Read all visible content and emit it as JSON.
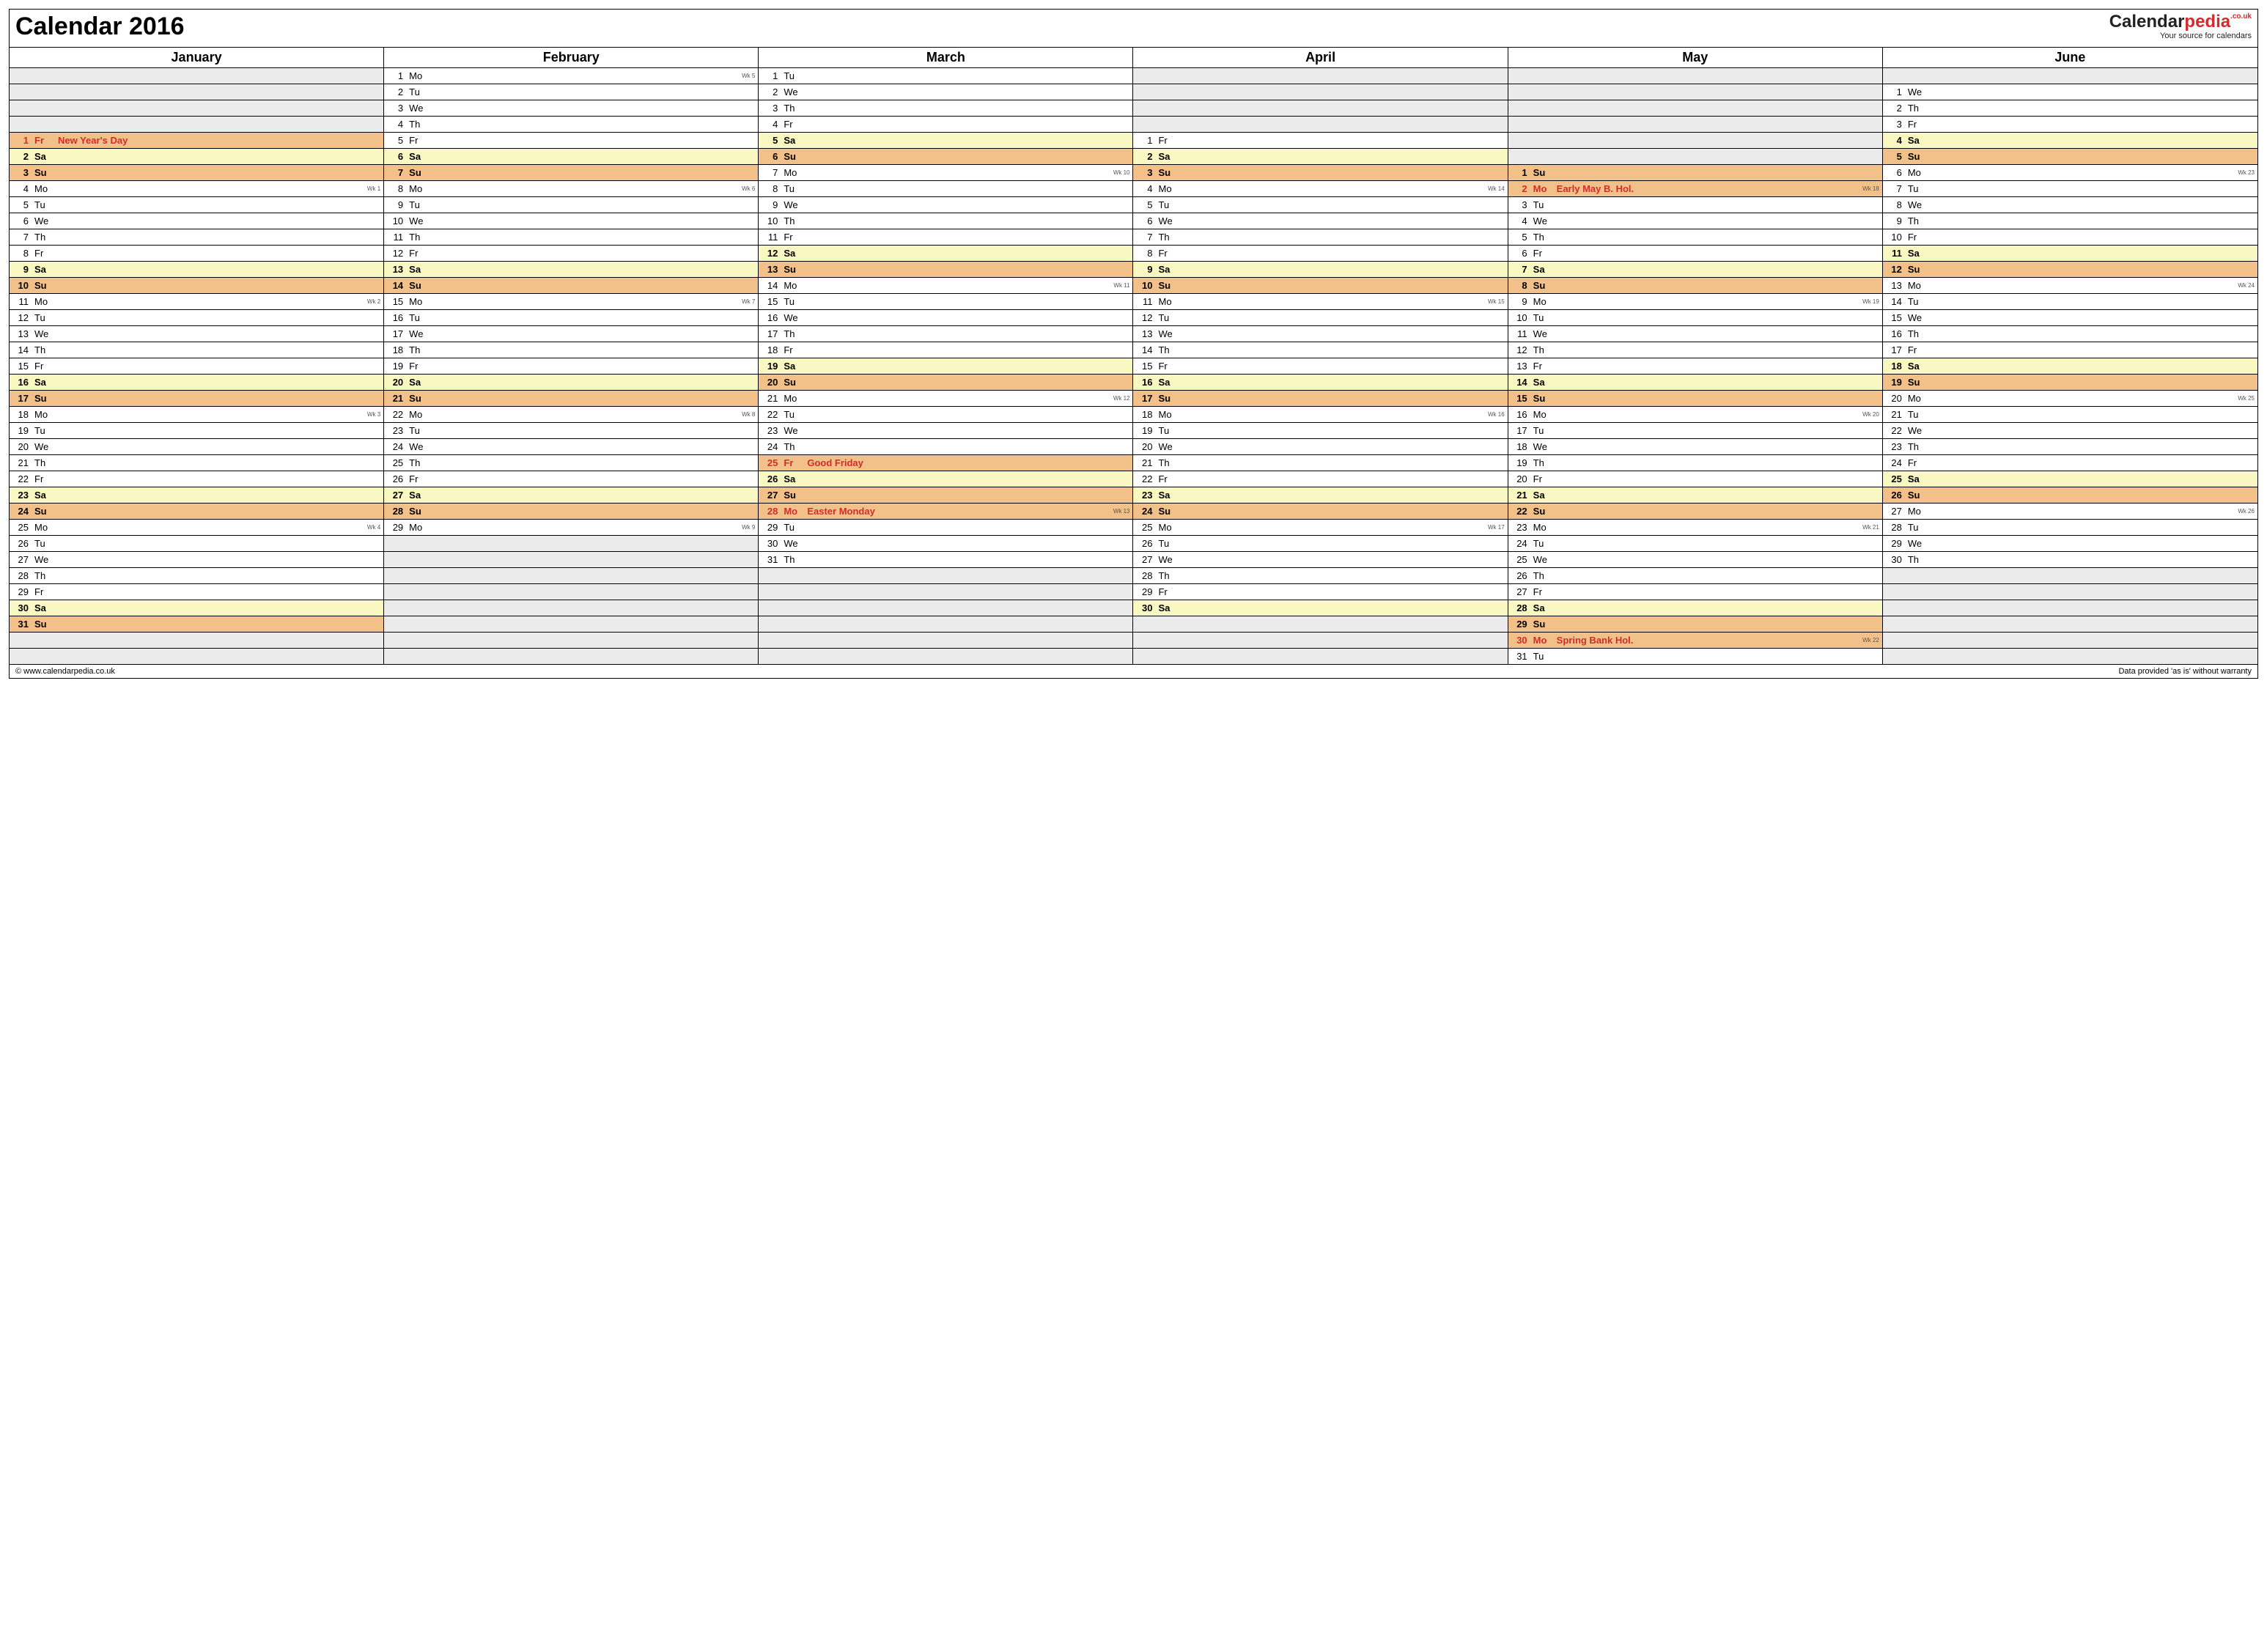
{
  "title": "Calendar 2016",
  "brand": {
    "dark": "Calendar",
    "red": "pedia",
    "tld": ".co.uk",
    "sub": "Your source for calendars"
  },
  "footer": {
    "left": "© www.calendarpedia.co.uk",
    "right": "Data provided 'as is' without warranty"
  },
  "leadBlanks": [
    4,
    0,
    0,
    4,
    6,
    1
  ],
  "months": [
    {
      "name": "January",
      "days": [
        {
          "n": 1,
          "d": "Fr",
          "t": "hol",
          "l": "New Year's Day"
        },
        {
          "n": 2,
          "d": "Sa",
          "t": "sat"
        },
        {
          "n": 3,
          "d": "Su",
          "t": "sun"
        },
        {
          "n": 4,
          "d": "Mo",
          "w": "Wk 1"
        },
        {
          "n": 5,
          "d": "Tu"
        },
        {
          "n": 6,
          "d": "We"
        },
        {
          "n": 7,
          "d": "Th"
        },
        {
          "n": 8,
          "d": "Fr"
        },
        {
          "n": 9,
          "d": "Sa",
          "t": "sat"
        },
        {
          "n": 10,
          "d": "Su",
          "t": "sun"
        },
        {
          "n": 11,
          "d": "Mo",
          "w": "Wk 2"
        },
        {
          "n": 12,
          "d": "Tu"
        },
        {
          "n": 13,
          "d": "We"
        },
        {
          "n": 14,
          "d": "Th"
        },
        {
          "n": 15,
          "d": "Fr"
        },
        {
          "n": 16,
          "d": "Sa",
          "t": "sat"
        },
        {
          "n": 17,
          "d": "Su",
          "t": "sun"
        },
        {
          "n": 18,
          "d": "Mo",
          "w": "Wk 3"
        },
        {
          "n": 19,
          "d": "Tu"
        },
        {
          "n": 20,
          "d": "We"
        },
        {
          "n": 21,
          "d": "Th"
        },
        {
          "n": 22,
          "d": "Fr"
        },
        {
          "n": 23,
          "d": "Sa",
          "t": "sat"
        },
        {
          "n": 24,
          "d": "Su",
          "t": "sun"
        },
        {
          "n": 25,
          "d": "Mo",
          "w": "Wk 4"
        },
        {
          "n": 26,
          "d": "Tu"
        },
        {
          "n": 27,
          "d": "We"
        },
        {
          "n": 28,
          "d": "Th"
        },
        {
          "n": 29,
          "d": "Fr"
        },
        {
          "n": 30,
          "d": "Sa",
          "t": "sat"
        },
        {
          "n": 31,
          "d": "Su",
          "t": "sun"
        }
      ]
    },
    {
      "name": "February",
      "days": [
        {
          "n": 1,
          "d": "Mo",
          "w": "Wk 5"
        },
        {
          "n": 2,
          "d": "Tu"
        },
        {
          "n": 3,
          "d": "We"
        },
        {
          "n": 4,
          "d": "Th"
        },
        {
          "n": 5,
          "d": "Fr"
        },
        {
          "n": 6,
          "d": "Sa",
          "t": "sat"
        },
        {
          "n": 7,
          "d": "Su",
          "t": "sun"
        },
        {
          "n": 8,
          "d": "Mo",
          "w": "Wk 6"
        },
        {
          "n": 9,
          "d": "Tu"
        },
        {
          "n": 10,
          "d": "We"
        },
        {
          "n": 11,
          "d": "Th"
        },
        {
          "n": 12,
          "d": "Fr"
        },
        {
          "n": 13,
          "d": "Sa",
          "t": "sat"
        },
        {
          "n": 14,
          "d": "Su",
          "t": "sun"
        },
        {
          "n": 15,
          "d": "Mo",
          "w": "Wk 7"
        },
        {
          "n": 16,
          "d": "Tu"
        },
        {
          "n": 17,
          "d": "We"
        },
        {
          "n": 18,
          "d": "Th"
        },
        {
          "n": 19,
          "d": "Fr"
        },
        {
          "n": 20,
          "d": "Sa",
          "t": "sat"
        },
        {
          "n": 21,
          "d": "Su",
          "t": "sun"
        },
        {
          "n": 22,
          "d": "Mo",
          "w": "Wk 8"
        },
        {
          "n": 23,
          "d": "Tu"
        },
        {
          "n": 24,
          "d": "We"
        },
        {
          "n": 25,
          "d": "Th"
        },
        {
          "n": 26,
          "d": "Fr"
        },
        {
          "n": 27,
          "d": "Sa",
          "t": "sat"
        },
        {
          "n": 28,
          "d": "Su",
          "t": "sun"
        },
        {
          "n": 29,
          "d": "Mo",
          "w": "Wk 9"
        }
      ]
    },
    {
      "name": "March",
      "days": [
        {
          "n": 1,
          "d": "Tu"
        },
        {
          "n": 2,
          "d": "We"
        },
        {
          "n": 3,
          "d": "Th"
        },
        {
          "n": 4,
          "d": "Fr"
        },
        {
          "n": 5,
          "d": "Sa",
          "t": "sat"
        },
        {
          "n": 6,
          "d": "Su",
          "t": "sun"
        },
        {
          "n": 7,
          "d": "Mo",
          "w": "Wk 10"
        },
        {
          "n": 8,
          "d": "Tu"
        },
        {
          "n": 9,
          "d": "We"
        },
        {
          "n": 10,
          "d": "Th"
        },
        {
          "n": 11,
          "d": "Fr"
        },
        {
          "n": 12,
          "d": "Sa",
          "t": "sat"
        },
        {
          "n": 13,
          "d": "Su",
          "t": "sun"
        },
        {
          "n": 14,
          "d": "Mo",
          "w": "Wk 11"
        },
        {
          "n": 15,
          "d": "Tu"
        },
        {
          "n": 16,
          "d": "We"
        },
        {
          "n": 17,
          "d": "Th"
        },
        {
          "n": 18,
          "d": "Fr"
        },
        {
          "n": 19,
          "d": "Sa",
          "t": "sat"
        },
        {
          "n": 20,
          "d": "Su",
          "t": "sun"
        },
        {
          "n": 21,
          "d": "Mo",
          "w": "Wk 12"
        },
        {
          "n": 22,
          "d": "Tu"
        },
        {
          "n": 23,
          "d": "We"
        },
        {
          "n": 24,
          "d": "Th"
        },
        {
          "n": 25,
          "d": "Fr",
          "t": "hol",
          "l": "Good Friday"
        },
        {
          "n": 26,
          "d": "Sa",
          "t": "sat"
        },
        {
          "n": 27,
          "d": "Su",
          "t": "sun"
        },
        {
          "n": 28,
          "d": "Mo",
          "t": "hol",
          "l": "Easter Monday",
          "w": "Wk 13"
        },
        {
          "n": 29,
          "d": "Tu"
        },
        {
          "n": 30,
          "d": "We"
        },
        {
          "n": 31,
          "d": "Th"
        }
      ]
    },
    {
      "name": "April",
      "days": [
        {
          "n": 1,
          "d": "Fr"
        },
        {
          "n": 2,
          "d": "Sa",
          "t": "sat"
        },
        {
          "n": 3,
          "d": "Su",
          "t": "sun"
        },
        {
          "n": 4,
          "d": "Mo",
          "w": "Wk 14"
        },
        {
          "n": 5,
          "d": "Tu"
        },
        {
          "n": 6,
          "d": "We"
        },
        {
          "n": 7,
          "d": "Th"
        },
        {
          "n": 8,
          "d": "Fr"
        },
        {
          "n": 9,
          "d": "Sa",
          "t": "sat"
        },
        {
          "n": 10,
          "d": "Su",
          "t": "sun"
        },
        {
          "n": 11,
          "d": "Mo",
          "w": "Wk 15"
        },
        {
          "n": 12,
          "d": "Tu"
        },
        {
          "n": 13,
          "d": "We"
        },
        {
          "n": 14,
          "d": "Th"
        },
        {
          "n": 15,
          "d": "Fr"
        },
        {
          "n": 16,
          "d": "Sa",
          "t": "sat"
        },
        {
          "n": 17,
          "d": "Su",
          "t": "sun"
        },
        {
          "n": 18,
          "d": "Mo",
          "w": "Wk 16"
        },
        {
          "n": 19,
          "d": "Tu"
        },
        {
          "n": 20,
          "d": "We"
        },
        {
          "n": 21,
          "d": "Th"
        },
        {
          "n": 22,
          "d": "Fr"
        },
        {
          "n": 23,
          "d": "Sa",
          "t": "sat"
        },
        {
          "n": 24,
          "d": "Su",
          "t": "sun"
        },
        {
          "n": 25,
          "d": "Mo",
          "w": "Wk 17"
        },
        {
          "n": 26,
          "d": "Tu"
        },
        {
          "n": 27,
          "d": "We"
        },
        {
          "n": 28,
          "d": "Th"
        },
        {
          "n": 29,
          "d": "Fr"
        },
        {
          "n": 30,
          "d": "Sa",
          "t": "sat"
        }
      ]
    },
    {
      "name": "May",
      "days": [
        {
          "n": 1,
          "d": "Su",
          "t": "sun"
        },
        {
          "n": 2,
          "d": "Mo",
          "t": "hol",
          "l": "Early May B. Hol.",
          "w": "Wk 18"
        },
        {
          "n": 3,
          "d": "Tu"
        },
        {
          "n": 4,
          "d": "We"
        },
        {
          "n": 5,
          "d": "Th"
        },
        {
          "n": 6,
          "d": "Fr"
        },
        {
          "n": 7,
          "d": "Sa",
          "t": "sat"
        },
        {
          "n": 8,
          "d": "Su",
          "t": "sun"
        },
        {
          "n": 9,
          "d": "Mo",
          "w": "Wk 19"
        },
        {
          "n": 10,
          "d": "Tu"
        },
        {
          "n": 11,
          "d": "We"
        },
        {
          "n": 12,
          "d": "Th"
        },
        {
          "n": 13,
          "d": "Fr"
        },
        {
          "n": 14,
          "d": "Sa",
          "t": "sat"
        },
        {
          "n": 15,
          "d": "Su",
          "t": "sun"
        },
        {
          "n": 16,
          "d": "Mo",
          "w": "Wk 20"
        },
        {
          "n": 17,
          "d": "Tu"
        },
        {
          "n": 18,
          "d": "We"
        },
        {
          "n": 19,
          "d": "Th"
        },
        {
          "n": 20,
          "d": "Fr"
        },
        {
          "n": 21,
          "d": "Sa",
          "t": "sat"
        },
        {
          "n": 22,
          "d": "Su",
          "t": "sun"
        },
        {
          "n": 23,
          "d": "Mo",
          "w": "Wk 21"
        },
        {
          "n": 24,
          "d": "Tu"
        },
        {
          "n": 25,
          "d": "We"
        },
        {
          "n": 26,
          "d": "Th"
        },
        {
          "n": 27,
          "d": "Fr"
        },
        {
          "n": 28,
          "d": "Sa",
          "t": "sat"
        },
        {
          "n": 29,
          "d": "Su",
          "t": "sun"
        },
        {
          "n": 30,
          "d": "Mo",
          "t": "hol",
          "l": "Spring Bank Hol.",
          "w": "Wk 22"
        },
        {
          "n": 31,
          "d": "Tu"
        }
      ]
    },
    {
      "name": "June",
      "days": [
        {
          "n": 1,
          "d": "We"
        },
        {
          "n": 2,
          "d": "Th"
        },
        {
          "n": 3,
          "d": "Fr"
        },
        {
          "n": 4,
          "d": "Sa",
          "t": "sat"
        },
        {
          "n": 5,
          "d": "Su",
          "t": "sun"
        },
        {
          "n": 6,
          "d": "Mo",
          "w": "Wk 23"
        },
        {
          "n": 7,
          "d": "Tu"
        },
        {
          "n": 8,
          "d": "We"
        },
        {
          "n": 9,
          "d": "Th"
        },
        {
          "n": 10,
          "d": "Fr"
        },
        {
          "n": 11,
          "d": "Sa",
          "t": "sat"
        },
        {
          "n": 12,
          "d": "Su",
          "t": "sun"
        },
        {
          "n": 13,
          "d": "Mo",
          "w": "Wk 24"
        },
        {
          "n": 14,
          "d": "Tu"
        },
        {
          "n": 15,
          "d": "We"
        },
        {
          "n": 16,
          "d": "Th"
        },
        {
          "n": 17,
          "d": "Fr"
        },
        {
          "n": 18,
          "d": "Sa",
          "t": "sat"
        },
        {
          "n": 19,
          "d": "Su",
          "t": "sun"
        },
        {
          "n": 20,
          "d": "Mo",
          "w": "Wk 25"
        },
        {
          "n": 21,
          "d": "Tu"
        },
        {
          "n": 22,
          "d": "We"
        },
        {
          "n": 23,
          "d": "Th"
        },
        {
          "n": 24,
          "d": "Fr"
        },
        {
          "n": 25,
          "d": "Sa",
          "t": "sat"
        },
        {
          "n": 26,
          "d": "Su",
          "t": "sun"
        },
        {
          "n": 27,
          "d": "Mo",
          "w": "Wk 26"
        },
        {
          "n": 28,
          "d": "Tu"
        },
        {
          "n": 29,
          "d": "We"
        },
        {
          "n": 30,
          "d": "Th"
        }
      ]
    }
  ]
}
